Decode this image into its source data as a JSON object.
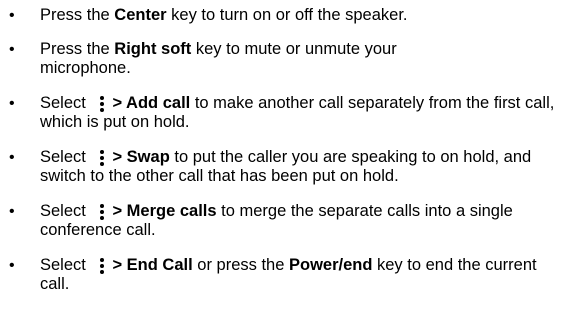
{
  "bullet_glyph": "•",
  "items": [
    {
      "pre": "Press the ",
      "bold1": "Center",
      "mid": " key to turn on or off the speaker.",
      "bold2": "",
      "post": ""
    },
    {
      "pre": "Press the ",
      "bold1": "Right soft",
      "mid": " key to mute or unmute your microphone.",
      "bold2": "",
      "post": ""
    },
    {
      "pre": "Select ",
      "icon": "menu-icon",
      "bold1": "> Add call",
      "mid": " to make another call separately from the first call, which is put on hold.",
      "bold2": "",
      "post": ""
    },
    {
      "pre": "Select ",
      "icon": "menu-icon",
      "bold1": "> Swap",
      "mid": " to put the caller you are speaking to on hold, and switch to the other call that has been put on hold.",
      "bold2": "",
      "post": ""
    },
    {
      "pre": "Select ",
      "icon": "menu-icon",
      "bold1": "> Merge calls",
      "mid": " to merge the separate calls into a single conference call.",
      "bold2": "",
      "post": ""
    },
    {
      "pre": "Select ",
      "icon": "menu-icon",
      "bold1": "> End Call",
      "mid": " or press the ",
      "bold2": "Power/end",
      "post": " key to end the current call."
    }
  ]
}
